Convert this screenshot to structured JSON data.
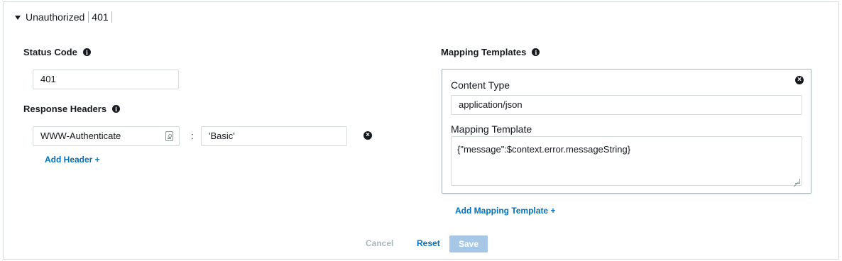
{
  "header": {
    "title": "Unauthorized",
    "code": "401"
  },
  "status_code": {
    "label": "Status Code",
    "value": "401"
  },
  "response_headers": {
    "label": "Response Headers",
    "items": [
      {
        "name": "WWW-Authenticate",
        "value": "'Basic'"
      }
    ],
    "separator": ":",
    "add_label": "Add Header +"
  },
  "mapping_templates": {
    "label": "Mapping Templates",
    "content_type_label": "Content Type",
    "content_type_value": "application/json",
    "template_label": "Mapping Template",
    "template_value": "{\"message\":$context.error.messageString}",
    "add_label": "Add Mapping Template +"
  },
  "actions": {
    "cancel": "Cancel",
    "reset": "Reset",
    "save": "Save"
  },
  "colors": {
    "link": "#0073bb",
    "save_disabled": "#a6c8e6",
    "border": "#d5dbdb"
  },
  "icons": {
    "info": "info-icon",
    "remove": "remove-icon",
    "caret": "caret-down-icon"
  }
}
